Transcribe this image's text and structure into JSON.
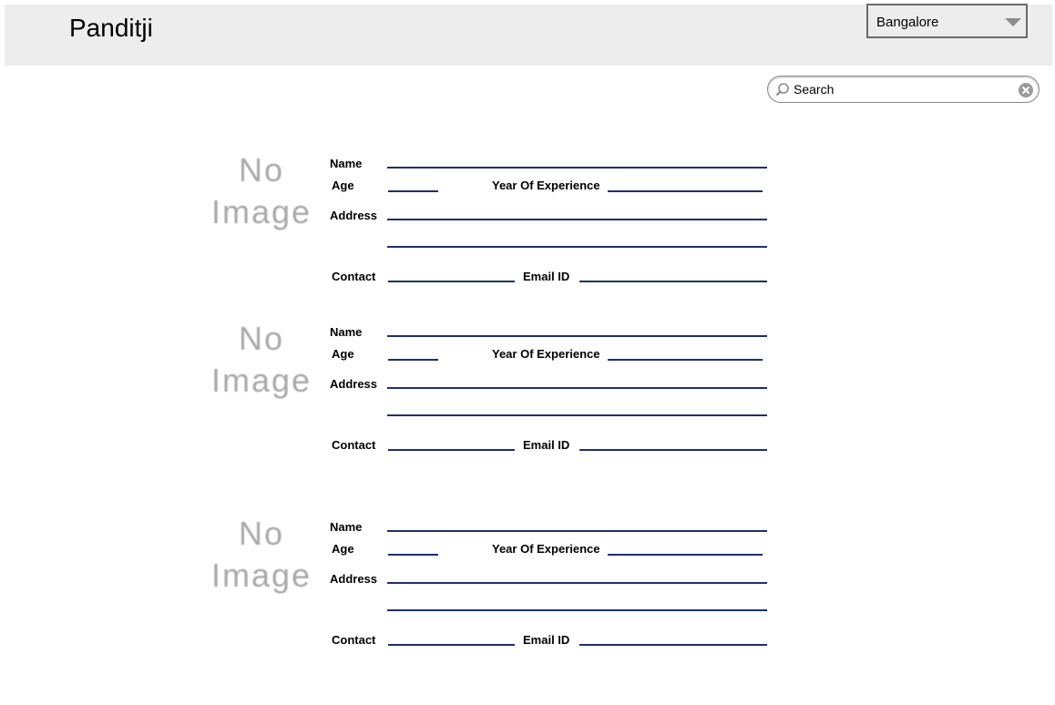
{
  "header": {
    "title": "Panditji",
    "city_select": {
      "value": "Bangalore"
    }
  },
  "search": {
    "placeholder": "Search"
  },
  "labels": {
    "name": "Name",
    "age": "Age",
    "experience": "Year Of Experience",
    "address": "Address",
    "contact": "Contact",
    "email": "Email ID"
  },
  "cards": [
    {
      "image_line1": "No",
      "image_line2": "Image"
    },
    {
      "image_line1": "No",
      "image_line2": "Image"
    },
    {
      "image_line1": "No",
      "image_line2": "Image"
    }
  ],
  "colors": {
    "header_bg": "#ededed",
    "field_line": "#1d2f6f",
    "placeholder_image_text": "#a9a9a9"
  },
  "icons": [
    "search-icon",
    "clear-icon",
    "chevron-down-icon"
  ]
}
